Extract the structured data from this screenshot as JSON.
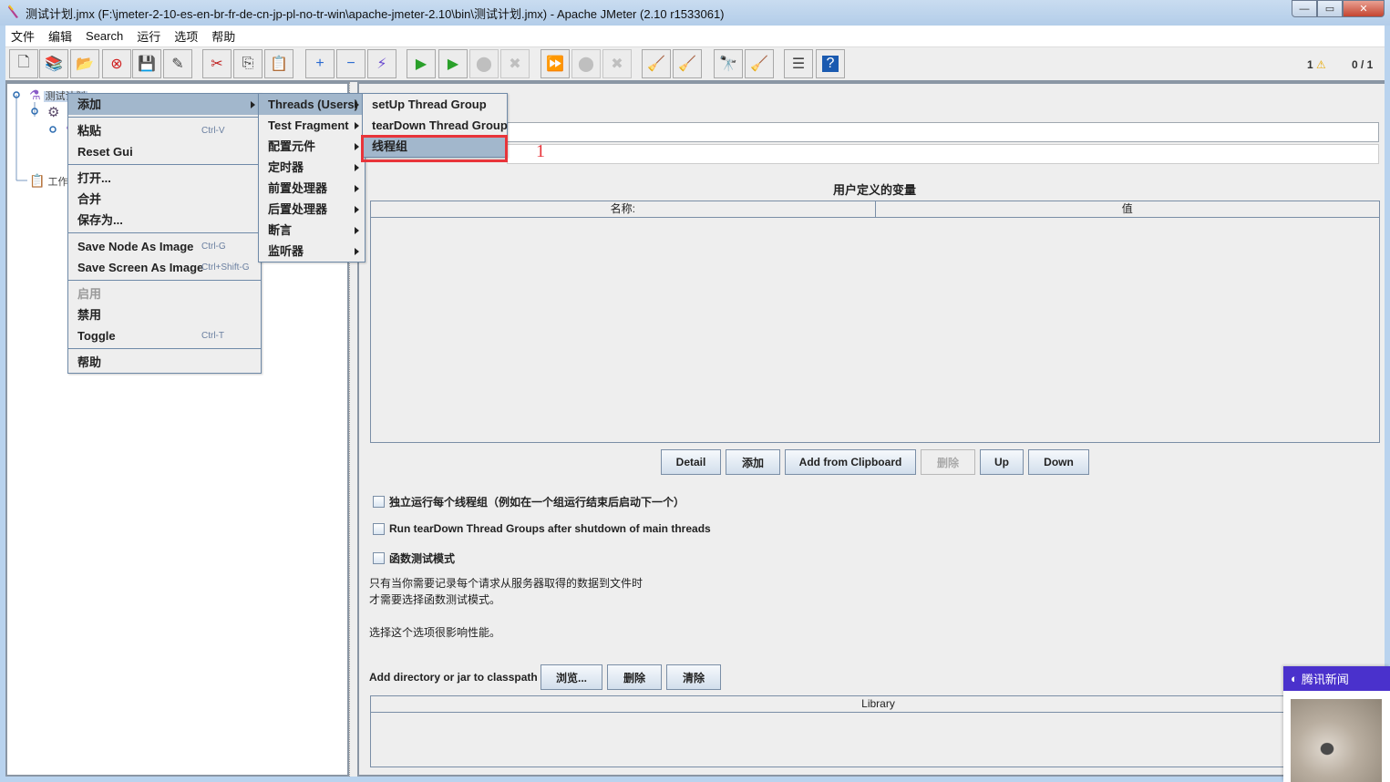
{
  "window": {
    "title": "测试计划.jmx (F:\\jmeter-2-10-es-en-br-fr-de-cn-jp-pl-no-tr-win\\apache-jmeter-2.10\\bin\\测试计划.jmx) - Apache JMeter (2.10 r1533061)",
    "controls": {
      "minimize": "—",
      "maximize": "▭",
      "close": "✕"
    }
  },
  "menubar": [
    "文件",
    "编辑",
    "Search",
    "运行",
    "选项",
    "帮助"
  ],
  "toolbar": {
    "buttons": [
      {
        "icon": "new-icon",
        "glyph": "🗋",
        "enabled": true
      },
      {
        "icon": "templates-icon",
        "glyph": "📚",
        "enabled": true
      },
      {
        "icon": "open-icon",
        "glyph": "📂",
        "enabled": true
      },
      {
        "icon": "close-file-icon",
        "glyph": "⊗",
        "enabled": true
      },
      {
        "icon": "save-icon",
        "glyph": "💾",
        "enabled": true
      },
      {
        "icon": "save-as-icon",
        "glyph": "✎",
        "enabled": true
      },
      {
        "icon": "cut-icon",
        "glyph": "✂",
        "enabled": true
      },
      {
        "icon": "copy-icon",
        "glyph": "⎘",
        "enabled": true
      },
      {
        "icon": "paste-icon",
        "glyph": "📋",
        "enabled": true
      },
      {
        "icon": "expand-icon",
        "glyph": "+",
        "enabled": true
      },
      {
        "icon": "collapse-icon",
        "glyph": "−",
        "enabled": true
      },
      {
        "icon": "toggle-icon",
        "glyph": "⚡",
        "enabled": true
      },
      {
        "icon": "start-icon",
        "glyph": "▶",
        "enabled": true
      },
      {
        "icon": "start-no-pause-icon",
        "glyph": "▶",
        "enabled": true
      },
      {
        "icon": "stop-icon",
        "glyph": "⬤",
        "enabled": false
      },
      {
        "icon": "shutdown-icon",
        "glyph": "✖",
        "enabled": false
      },
      {
        "icon": "remote-start-icon",
        "glyph": "⏩",
        "enabled": true
      },
      {
        "icon": "remote-stop-icon",
        "glyph": "⬤",
        "enabled": false
      },
      {
        "icon": "remote-shutdown-icon",
        "glyph": "✖",
        "enabled": false
      },
      {
        "icon": "clear-icon",
        "glyph": "🧹",
        "enabled": true
      },
      {
        "icon": "clear-all-icon",
        "glyph": "🧹",
        "enabled": true
      },
      {
        "icon": "search-icon",
        "glyph": "🔭",
        "enabled": true
      },
      {
        "icon": "reset-search-icon",
        "glyph": "🧹",
        "enabled": true
      },
      {
        "icon": "function-helper-icon",
        "glyph": "☰",
        "enabled": true
      },
      {
        "icon": "help-icon",
        "glyph": "?",
        "enabled": true
      }
    ],
    "warning_count": "1",
    "threads": "0 / 1"
  },
  "tree": {
    "nodes": [
      {
        "label": "测试计划",
        "icon": "test-plan-icon"
      },
      {
        "label": "",
        "icon": "thread-group-icon"
      },
      {
        "label": "",
        "icon": "sampler-icon"
      },
      {
        "label": "工作台",
        "icon": "workbench-icon"
      }
    ]
  },
  "context_menu": {
    "items": [
      {
        "label": "添加",
        "submenu": true,
        "selected": true
      },
      {
        "sep": true
      },
      {
        "label": "粘贴",
        "shortcut": "Ctrl-V"
      },
      {
        "label": "Reset Gui"
      },
      {
        "sep": true
      },
      {
        "label": "打开..."
      },
      {
        "label": "合并"
      },
      {
        "label": "保存为..."
      },
      {
        "sep": true
      },
      {
        "label": "Save Node As Image",
        "shortcut": "Ctrl-G"
      },
      {
        "label": "Save Screen As Image",
        "shortcut": "Ctrl+Shift-G"
      },
      {
        "sep": true
      },
      {
        "label": "启用",
        "disabled": true
      },
      {
        "label": "禁用"
      },
      {
        "label": "Toggle",
        "shortcut": "Ctrl-T"
      },
      {
        "sep": true
      },
      {
        "label": "帮助"
      }
    ]
  },
  "add_submenu": {
    "items": [
      {
        "label": "Threads (Users)",
        "selected": true
      },
      {
        "label": "Test Fragment"
      },
      {
        "label": "配置元件"
      },
      {
        "label": "定时器"
      },
      {
        "label": "前置处理器"
      },
      {
        "label": "后置处理器"
      },
      {
        "label": "断言"
      },
      {
        "label": "监听器"
      }
    ]
  },
  "threads_submenu": {
    "items": [
      {
        "label": "setUp Thread Group"
      },
      {
        "label": "tearDown Thread Group"
      },
      {
        "label": "线程组",
        "selected": true
      }
    ]
  },
  "annotation": {
    "label": "1",
    "color": "#e8343a"
  },
  "main": {
    "name_value": "",
    "comment_value": "",
    "variables_title": "用户定义的变量",
    "columns": [
      "名称:",
      "值"
    ],
    "buttons": [
      {
        "label": "Detail",
        "enabled": true
      },
      {
        "label": "添加",
        "enabled": true
      },
      {
        "label": "Add from Clipboard",
        "enabled": true
      },
      {
        "label": "删除",
        "enabled": false
      },
      {
        "label": "Up",
        "enabled": true
      },
      {
        "label": "Down",
        "enabled": true
      }
    ],
    "checkboxes": [
      {
        "label": "独立运行每个线程组（例如在一个组运行结束后启动下一个）",
        "checked": false
      },
      {
        "label": "Run tearDown Thread Groups after shutdown of main threads",
        "checked": false
      },
      {
        "label": "函数测试模式",
        "checked": false
      }
    ],
    "help_line1": "只有当你需要记录每个请求从服务器取得的数据到文件时",
    "help_line2": "才需要选择函数测试模式。",
    "help_line3": "选择这个选项很影响性能。",
    "classpath_label": "Add directory or jar to classpath",
    "classpath_buttons": [
      "浏览...",
      "删除",
      "清除"
    ],
    "library_header": "Library"
  },
  "news_popup": {
    "title": "腾讯新闻"
  }
}
